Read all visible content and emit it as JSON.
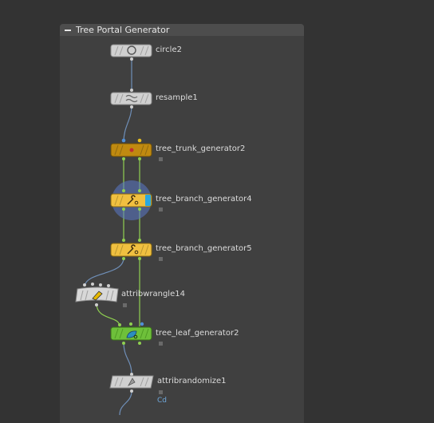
{
  "network_box": {
    "title": "Tree Portal Generator"
  },
  "nodes": [
    {
      "name": "circle2",
      "kind": "circle",
      "color": "#cfcfcf"
    },
    {
      "name": "resample1",
      "kind": "resample",
      "color": "#cfcfcf"
    },
    {
      "name": "tree_trunk_generator2",
      "kind": "hda",
      "color": "#b8860b"
    },
    {
      "name": "tree_branch_generator4",
      "kind": "hda",
      "color": "#f0c040"
    },
    {
      "name": "tree_branch_generator5",
      "kind": "hda",
      "color": "#f0c040"
    },
    {
      "name": "attribwrangle14",
      "kind": "wrangle",
      "color": "#d6d6d6"
    },
    {
      "name": "tree_leaf_generator2",
      "kind": "hda",
      "color": "#6ec03a"
    },
    {
      "name": "attribrandomize1",
      "kind": "randomize",
      "color": "#cfcfcf"
    }
  ],
  "attribute_badge": "Cd",
  "colors": {
    "wire_blue": "#6f8fb8",
    "wire_green": "#8fd050",
    "wire_gray": "#9a9a9a",
    "selected_ring": "#5a78c8"
  }
}
